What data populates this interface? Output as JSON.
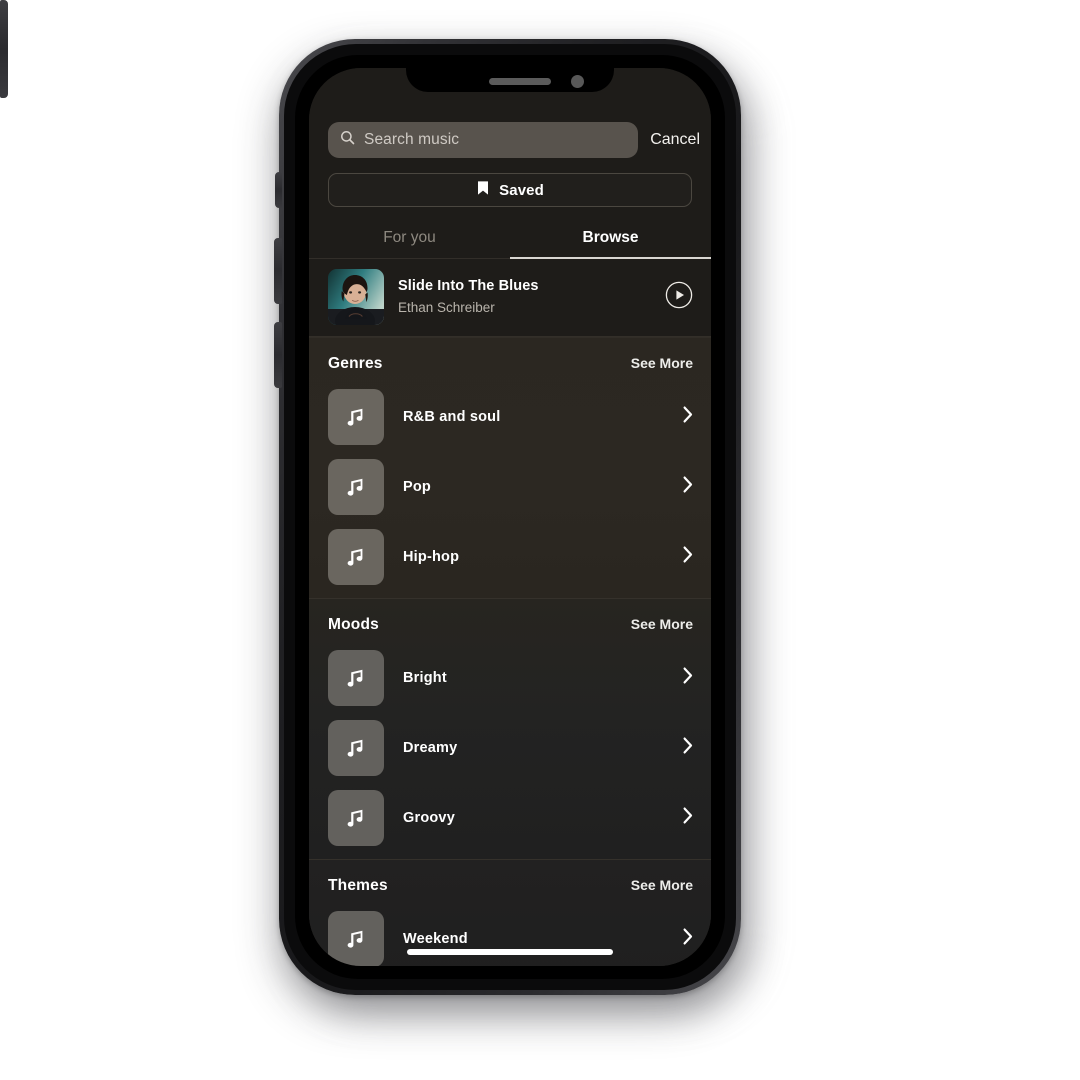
{
  "device": {
    "name": "smartphone-mockup",
    "notch": {
      "speaker": "earpiece-speaker",
      "camera": "front-camera"
    },
    "buttons": [
      "mute-switch",
      "volume-up",
      "volume-down",
      "power"
    ]
  },
  "search": {
    "placeholder": "Search music",
    "value": "",
    "icon": "search-icon",
    "cancel_label": "Cancel"
  },
  "saved": {
    "label": "Saved",
    "icon": "bookmark-icon"
  },
  "tabs": [
    {
      "label": "For you",
      "active": false
    },
    {
      "label": "Browse",
      "active": true
    }
  ],
  "result": {
    "title": "Slide Into The Blues",
    "artist": "Ethan Schreiber",
    "artwork": "album-artwork-portrait",
    "play_icon": "play-circle-icon"
  },
  "sections": [
    {
      "title": "Genres",
      "see_more": "See More",
      "items": [
        {
          "label": "R&B and soul",
          "icon": "music-note-icon",
          "chevron": "chevron-right-icon"
        },
        {
          "label": "Pop",
          "icon": "music-note-icon",
          "chevron": "chevron-right-icon"
        },
        {
          "label": "Hip-hop",
          "icon": "music-note-icon",
          "chevron": "chevron-right-icon"
        }
      ]
    },
    {
      "title": "Moods",
      "see_more": "See More",
      "items": [
        {
          "label": "Bright",
          "icon": "music-note-icon",
          "chevron": "chevron-right-icon"
        },
        {
          "label": "Dreamy",
          "icon": "music-note-icon",
          "chevron": "chevron-right-icon"
        },
        {
          "label": "Groovy",
          "icon": "music-note-icon",
          "chevron": "chevron-right-icon"
        }
      ]
    },
    {
      "title": "Themes",
      "see_more": "See More",
      "items": [
        {
          "label": "Weekend",
          "icon": "music-note-icon",
          "chevron": "chevron-right-icon"
        }
      ]
    }
  ],
  "colors": {
    "page_background": "#ffffff",
    "screen_background": "#1e1c19",
    "genres_background": "#2b2721",
    "moods_background": "#242320",
    "themes_background": "#1f1f1f",
    "search_field": "#58534d",
    "thumb_tile": "#6a665f",
    "text_primary": "#ffffff",
    "text_secondary": "#b9b4ac",
    "tab_inactive": "#8e8980",
    "home_indicator": "#ffffff"
  },
  "home_indicator": "home-indicator-bar"
}
